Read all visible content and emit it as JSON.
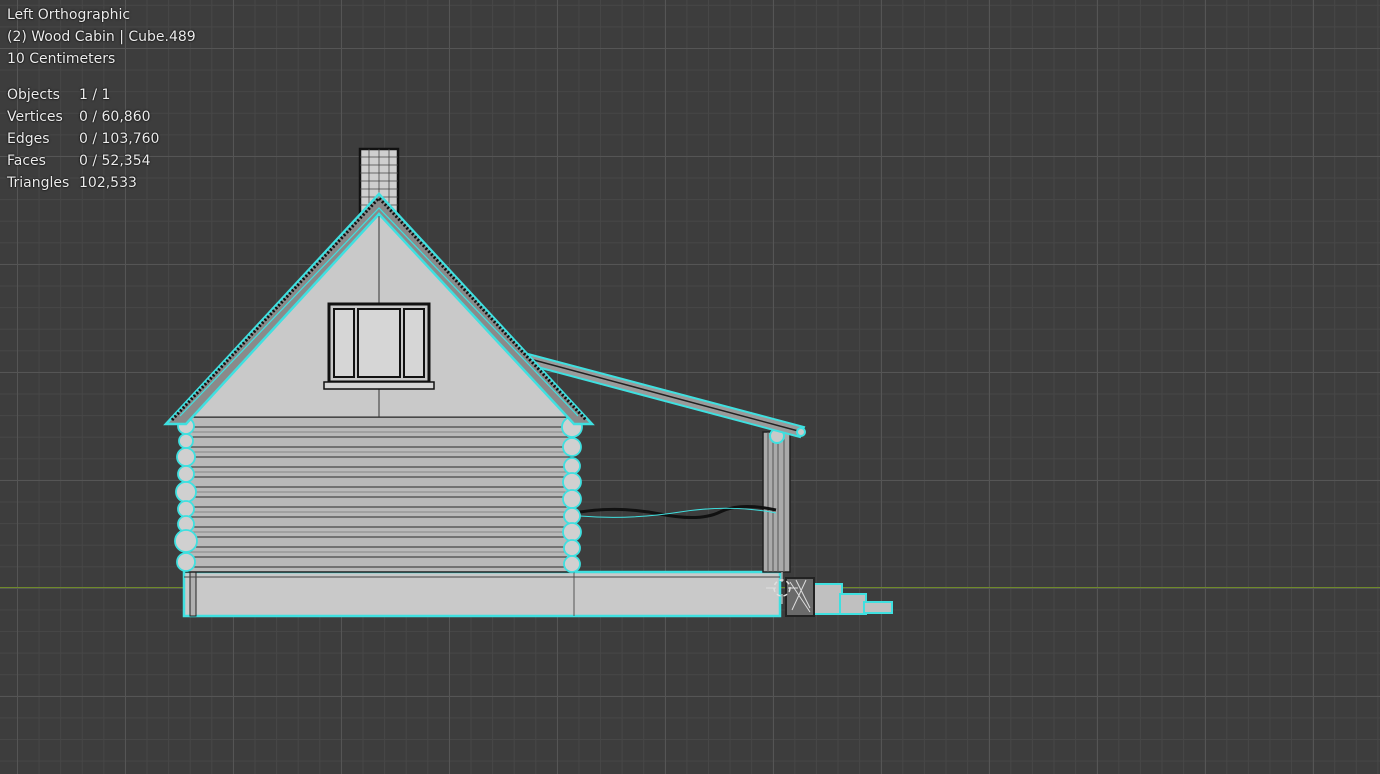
{
  "viewport": {
    "view_name": "Left Orthographic",
    "collection_object": "(2) Wood Cabin | Cube.489",
    "grid_scale": "10 Centimeters"
  },
  "statistics": [
    {
      "label": "Objects",
      "value": "1 / 1"
    },
    {
      "label": "Vertices",
      "value": "0 / 60,860"
    },
    {
      "label": "Edges",
      "value": "0 / 103,760"
    },
    {
      "label": "Faces",
      "value": "0 / 52,354"
    },
    {
      "label": "Triangles",
      "value": "102,533"
    }
  ],
  "colors": {
    "background": "#3d3d3d",
    "selection_outline": "#3fe0e0",
    "mesh_fill": "#c8c8c8",
    "x_axis": "#6f8a2a"
  }
}
